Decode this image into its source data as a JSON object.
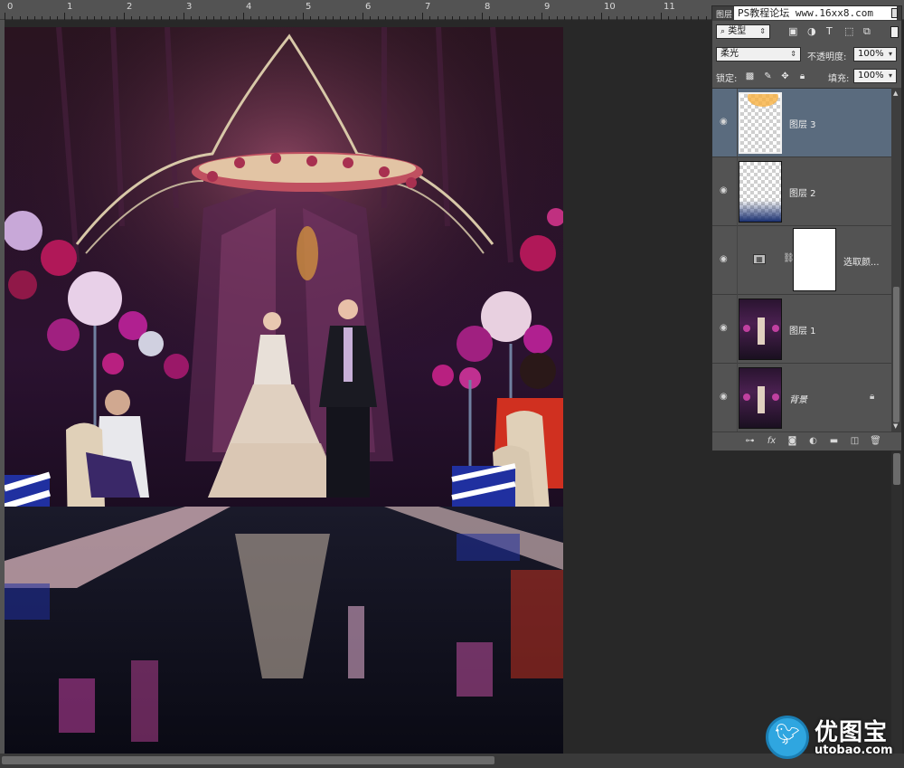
{
  "ruler": {
    "numbers": [
      "0",
      "1",
      "2",
      "3",
      "4",
      "5",
      "6",
      "7",
      "8",
      "9",
      "10",
      "11"
    ]
  },
  "layers_panel": {
    "tab_label": "图层",
    "watermark_text": "PS教程论坛 www.16xx8.com",
    "filter_label": "类型",
    "filter_icons": [
      "image-filter-icon",
      "adjustment-filter-icon",
      "type-filter-icon",
      "shape-filter-icon",
      "smart-object-filter-icon"
    ],
    "blend_mode": "柔光",
    "opacity_label": "不透明度:",
    "opacity_value": "100%",
    "lock_label": "锁定:",
    "fill_label": "填充:",
    "fill_value": "100%",
    "layers": [
      {
        "name": "图层 3",
        "selected": true,
        "visible": true
      },
      {
        "name": "图层 2",
        "selected": false,
        "visible": true
      },
      {
        "name": "选取颜...",
        "selected": false,
        "visible": true,
        "type": "adjustment"
      },
      {
        "name": "图层 1",
        "selected": false,
        "visible": true
      },
      {
        "name": "背景",
        "selected": false,
        "visible": true,
        "locked": true
      }
    ],
    "footer_buttons": [
      "link-layers-icon",
      "fx-icon",
      "add-mask-icon",
      "new-adjustment-icon",
      "new-group-icon",
      "new-layer-icon",
      "delete-icon"
    ]
  },
  "logo": {
    "cn_text": "优图宝",
    "en_text": "utobao.com"
  },
  "colors": {
    "workspace": "#282828",
    "panel": "#535353",
    "selected_layer": "#5a6b7e",
    "logo_blue": "#2fa6e0"
  }
}
